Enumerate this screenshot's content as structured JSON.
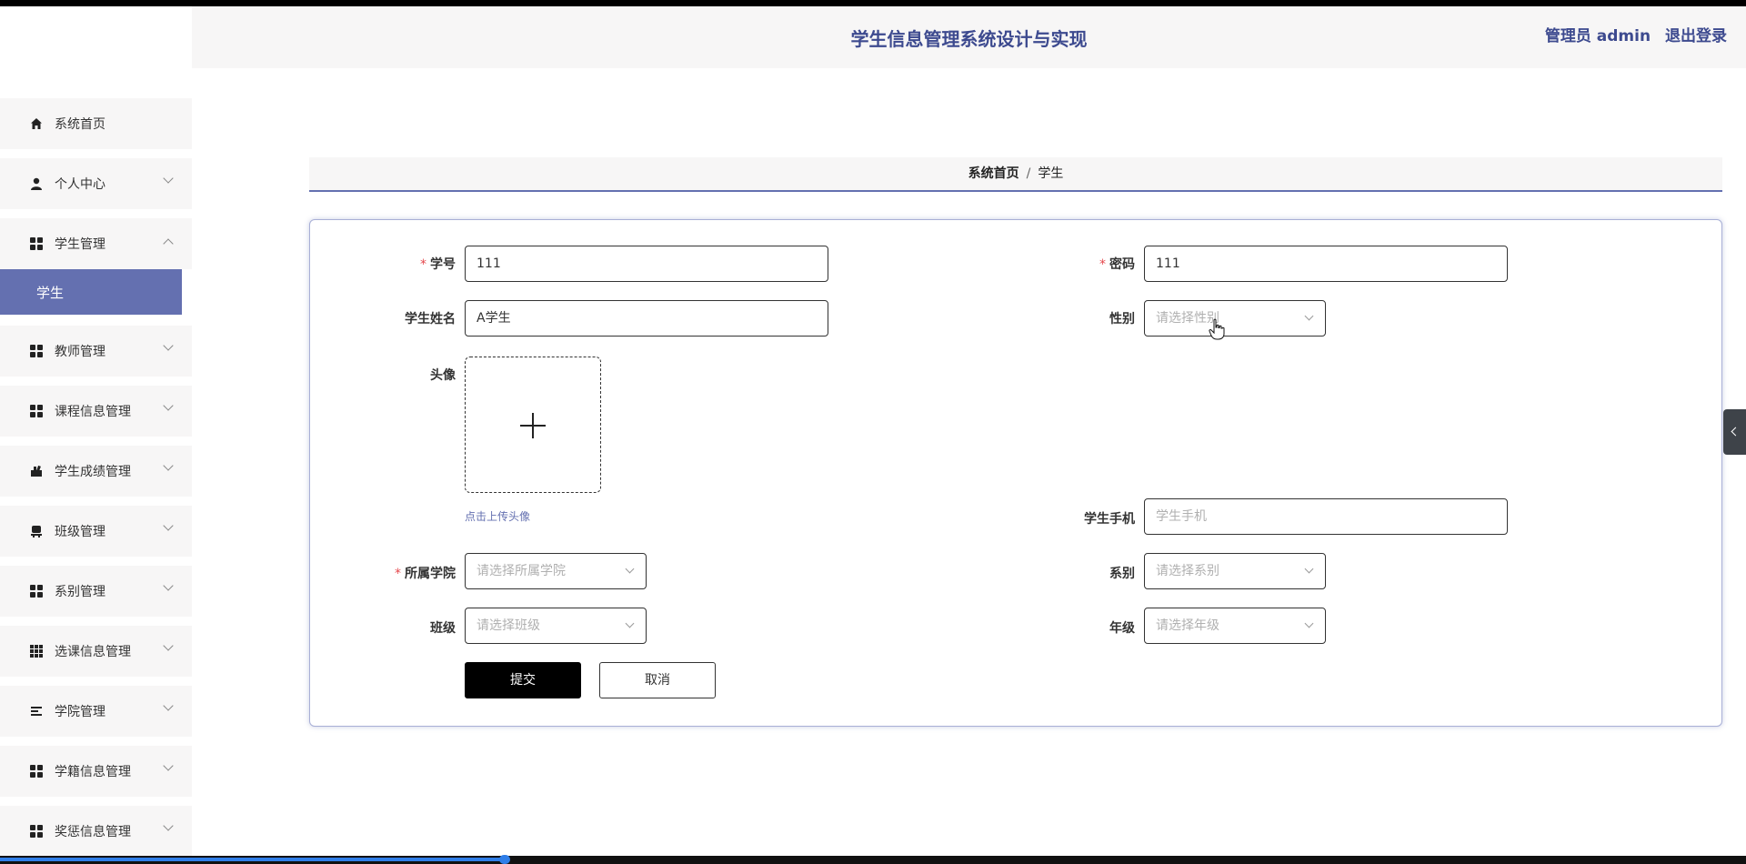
{
  "header": {
    "title": "学生信息管理系统设计与实现",
    "user_label": "管理员 admin",
    "logout_label": "退出登录"
  },
  "sidebar": {
    "items": [
      {
        "label": "系统首页",
        "icon": "home-icon"
      },
      {
        "label": "个人中心",
        "icon": "user-icon"
      },
      {
        "label": "学生管理",
        "icon": "grid-icon"
      },
      {
        "label": "教师管理",
        "icon": "grid-icon"
      },
      {
        "label": "课程信息管理",
        "icon": "grid-icon"
      },
      {
        "label": "学生成绩管理",
        "icon": "cup-icon"
      },
      {
        "label": "班级管理",
        "icon": "chair-icon"
      },
      {
        "label": "系别管理",
        "icon": "grid-icon"
      },
      {
        "label": "选课信息管理",
        "icon": "grid9-icon"
      },
      {
        "label": "学院管理",
        "icon": "list-icon"
      },
      {
        "label": "学籍信息管理",
        "icon": "grid-icon"
      },
      {
        "label": "奖惩信息管理",
        "icon": "grid-icon"
      }
    ],
    "active_sub": "学生"
  },
  "breadcrumb": {
    "home": "系统首页",
    "separator": "/",
    "current": "学生"
  },
  "form": {
    "student_no": {
      "label": "学号",
      "value": "111"
    },
    "password": {
      "label": "密码",
      "value": "111"
    },
    "student_name": {
      "label": "学生姓名",
      "value": "A学生"
    },
    "gender": {
      "label": "性别",
      "placeholder": "请选择性别"
    },
    "avatar": {
      "label": "头像",
      "hint": "点击上传头像"
    },
    "phone": {
      "label": "学生手机",
      "placeholder": "学生手机"
    },
    "college": {
      "label": "所属学院",
      "placeholder": "请选择所属学院"
    },
    "department": {
      "label": "系别",
      "placeholder": "请选择系别"
    },
    "class": {
      "label": "班级",
      "placeholder": "请选择班级"
    },
    "grade": {
      "label": "年级",
      "placeholder": "请选择年级"
    },
    "required_mark": "*",
    "submit_label": "提交",
    "cancel_label": "取消"
  },
  "colors": {
    "accent": "#6470b0",
    "title": "#3d4a8f",
    "required": "#e5484d"
  }
}
